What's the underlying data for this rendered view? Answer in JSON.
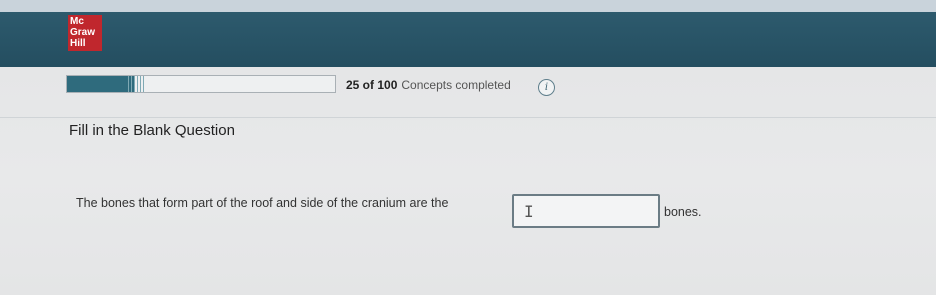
{
  "brand": {
    "logo_lines": [
      "Mc",
      "Graw",
      "Hill"
    ],
    "logo_color": "#c0272d",
    "header_color": "#2d5a6d"
  },
  "progress": {
    "completed": 25,
    "total": 100,
    "count_text": "25 of 100",
    "label": "Concepts completed",
    "fraction": 0.25,
    "fill_color": "#2f6b7d",
    "info_icon": "info-icon"
  },
  "question": {
    "title": "Fill in the Blank Question",
    "text_before": "The bones that form part of the roof and side of the cranium are the",
    "blank_value": "",
    "text_after": "bones.",
    "cursor_icon": "text-cursor-icon"
  }
}
